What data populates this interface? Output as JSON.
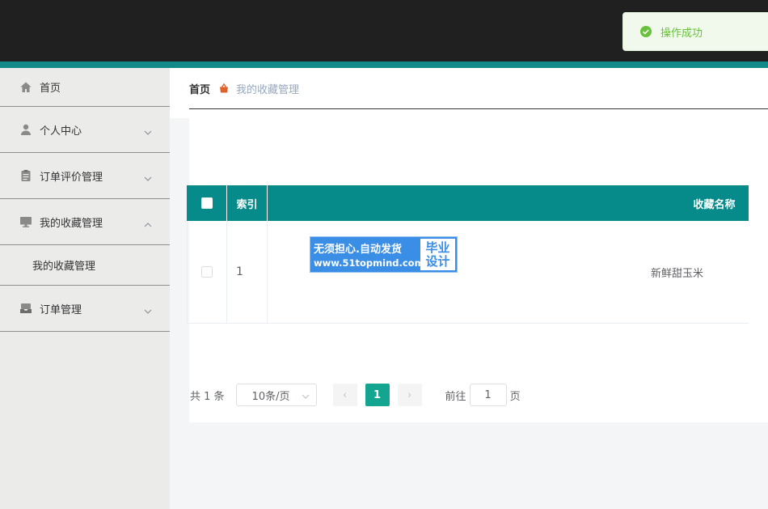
{
  "sidebar": {
    "items": [
      {
        "label": "首页",
        "icon": "home-icon"
      },
      {
        "label": "个人中心",
        "icon": "user-icon"
      },
      {
        "label": "订单评价管理",
        "icon": "clipboard-icon"
      },
      {
        "label": "我的收藏管理",
        "icon": "monitor-icon",
        "expanded": true,
        "children": [
          {
            "label": "我的收藏管理"
          }
        ]
      },
      {
        "label": "订单管理",
        "icon": "inbox-icon"
      }
    ]
  },
  "breadcrumb": {
    "home": "首页",
    "current": "我的收藏管理"
  },
  "table": {
    "columns": {
      "index": "索引",
      "name": "收藏名称"
    },
    "rows": [
      {
        "index": "1",
        "name": "新鲜甜玉米"
      }
    ]
  },
  "pagination": {
    "total": "共 1 条",
    "page_size": "10条/页",
    "current_page": "1",
    "goto_prefix": "前往",
    "goto_value": "1",
    "goto_suffix": "页",
    "prev": "‹",
    "next": "›"
  },
  "watermark": {
    "line1": "无须担心.自动发货",
    "line2": "www.51topmind.com",
    "badge_top": "毕业",
    "badge_bottom": "设计"
  },
  "toast": {
    "message": "操作成功"
  },
  "colors": {
    "header": "#202020",
    "accent": "#138a8a",
    "table_header": "#078a8a",
    "pager_active": "#13a590",
    "success": "#67c23a"
  }
}
